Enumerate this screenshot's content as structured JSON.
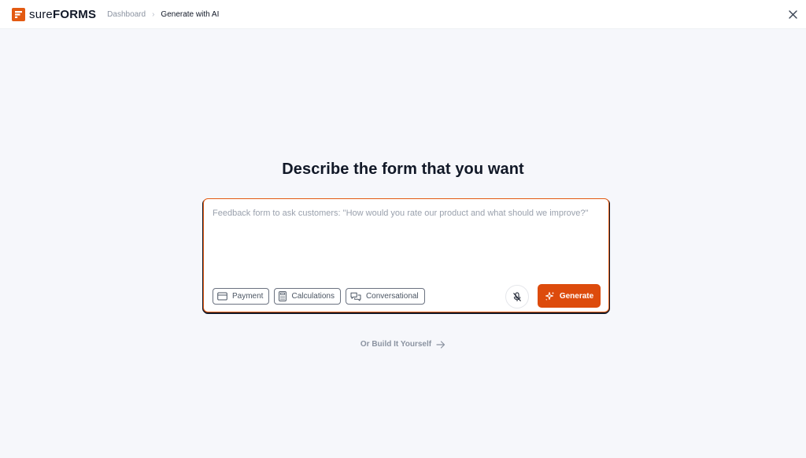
{
  "brand": {
    "name_light": "sure",
    "name_bold": "FORMS",
    "accent": "#e35a12"
  },
  "breadcrumb": {
    "parent": "Dashboard",
    "separator": "›",
    "current": "Generate with AI"
  },
  "header": {
    "close_icon": "close-icon"
  },
  "main": {
    "title": "Describe the form that you want",
    "prompt": {
      "value": "",
      "placeholder": "Feedback form to ask customers: \"How would you rate our product and what should we improve?\""
    },
    "chips": [
      {
        "label": "Payment",
        "icon": "credit-card-icon"
      },
      {
        "label": "Calculations",
        "icon": "calculator-icon"
      },
      {
        "label": "Conversational",
        "icon": "chat-bubbles-icon"
      }
    ],
    "mic_icon": "microphone-off-icon",
    "generate_label": "Generate",
    "generate_color": "#dd4b0c",
    "build_link_label": "Or Build It Yourself"
  }
}
